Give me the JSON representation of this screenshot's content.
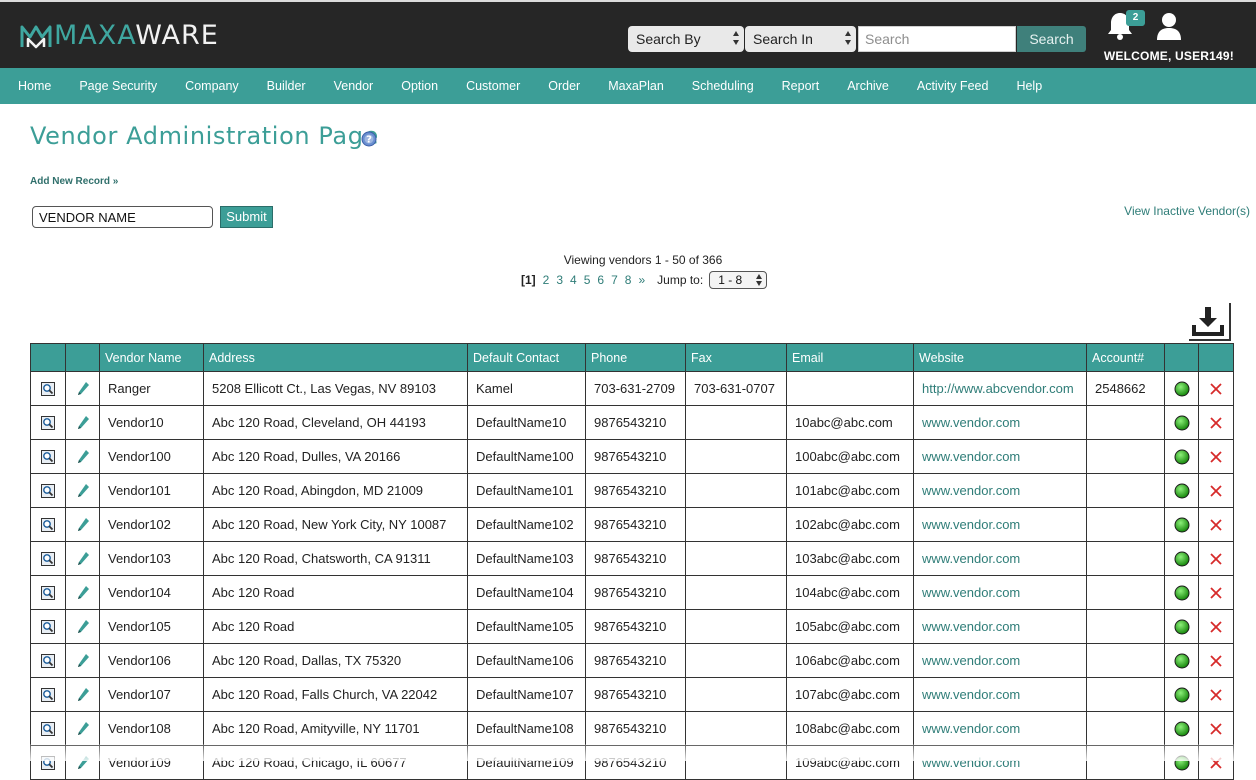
{
  "header": {
    "logo_text_a": "MAXA",
    "logo_text_b": "WARE",
    "search_by": "Search By",
    "search_in": "Search In",
    "search_placeholder": "Search",
    "search_button": "Search",
    "notification_count": "2",
    "welcome": "WELCOME, USER149!",
    "icons": [
      "bell-icon",
      "user-icon"
    ]
  },
  "nav": [
    "Home",
    "Page Security",
    "Company",
    "Builder",
    "Vendor",
    "Option",
    "Customer",
    "Order",
    "MaxaPlan",
    "Scheduling",
    "Report",
    "Archive",
    "Activity Feed",
    "Help"
  ],
  "page": {
    "title": "Vendor Administration Page",
    "add_new": "Add New Record »",
    "filter_value": "VENDOR NAME",
    "submit": "Submit",
    "view_inactive": "View Inactive Vendor(s)",
    "viewing": "Viewing vendors 1 - 50 of 366",
    "pager": {
      "current": "[1]",
      "pages": [
        "2",
        "3",
        "4",
        "5",
        "6",
        "7",
        "8",
        "»"
      ],
      "jump_label": "Jump to:",
      "jump_value": "1 - 8"
    }
  },
  "colors": {
    "accent": "#3c9e97",
    "header_bg": "#262626",
    "link": "#2f7d78"
  },
  "table": {
    "columns": [
      "",
      "",
      "Vendor Name",
      "Address",
      "Default Contact",
      "Phone",
      "Fax",
      "Email",
      "Website",
      "Account#",
      "",
      ""
    ],
    "rows": [
      [
        "Ranger",
        "5208 Ellicott Ct., Las Vegas, NV 89103",
        "Kamel",
        "703-631-2709",
        "703-631-0707",
        "",
        "http://www.abcvendor.com",
        "2548662"
      ],
      [
        "Vendor10",
        "Abc 120 Road, Cleveland, OH 44193",
        "DefaultName10",
        "9876543210",
        "",
        "10abc@abc.com",
        "www.vendor.com",
        ""
      ],
      [
        "Vendor100",
        "Abc 120 Road, Dulles, VA 20166",
        "DefaultName100",
        "9876543210",
        "",
        "100abc@abc.com",
        "www.vendor.com",
        ""
      ],
      [
        "Vendor101",
        "Abc 120 Road, Abingdon, MD 21009",
        "DefaultName101",
        "9876543210",
        "",
        "101abc@abc.com",
        "www.vendor.com",
        ""
      ],
      [
        "Vendor102",
        "Abc 120 Road, New York City, NY 10087",
        "DefaultName102",
        "9876543210",
        "",
        "102abc@abc.com",
        "www.vendor.com",
        ""
      ],
      [
        "Vendor103",
        "Abc 120 Road, Chatsworth, CA 91311",
        "DefaultName103",
        "9876543210",
        "",
        "103abc@abc.com",
        "www.vendor.com",
        ""
      ],
      [
        "Vendor104",
        "Abc 120 Road",
        "DefaultName104",
        "9876543210",
        "",
        "104abc@abc.com",
        "www.vendor.com",
        ""
      ],
      [
        "Vendor105",
        "Abc 120 Road",
        "DefaultName105",
        "9876543210",
        "",
        "105abc@abc.com",
        "www.vendor.com",
        ""
      ],
      [
        "Vendor106",
        "Abc 120 Road, Dallas, TX 75320",
        "DefaultName106",
        "9876543210",
        "",
        "106abc@abc.com",
        "www.vendor.com",
        ""
      ],
      [
        "Vendor107",
        "Abc 120 Road, Falls Church, VA 22042",
        "DefaultName107",
        "9876543210",
        "",
        "107abc@abc.com",
        "www.vendor.com",
        ""
      ],
      [
        "Vendor108",
        "Abc 120 Road, Amityville, NY 11701",
        "DefaultName108",
        "9876543210",
        "",
        "108abc@abc.com",
        "www.vendor.com",
        ""
      ],
      [
        "Vendor109",
        "Abc 120 Road, Chicago, IL 60677",
        "DefaultName109",
        "9876543210",
        "",
        "109abc@abc.com",
        "www.vendor.com",
        ""
      ]
    ]
  }
}
